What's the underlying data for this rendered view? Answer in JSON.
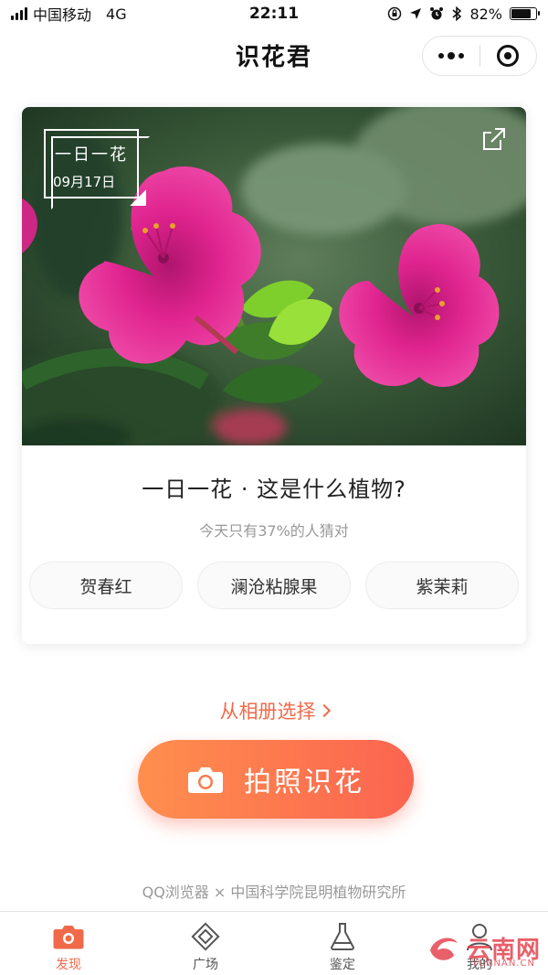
{
  "status_bar": {
    "carrier": "中国移动",
    "network": "4G",
    "time": "22:11",
    "battery_percent": "82%",
    "battery_level": 0.82
  },
  "nav": {
    "title": "识花君",
    "more_icon": "more-dots-icon",
    "close_icon": "target-circle-icon"
  },
  "card": {
    "badge_title": "一日一花",
    "badge_date": "09月17日",
    "share_icon": "share-icon",
    "question": "一日一花 · 这是什么植物?",
    "hint": "今天只有37%的人猜对",
    "options": [
      "贺春红",
      "澜沧粘腺果",
      "紫茉莉"
    ]
  },
  "album_link": "从相册选择",
  "camera_button": "拍照识花",
  "credit": "QQ浏览器 × 中国科学院昆明植物研究所",
  "tabs": [
    {
      "label": "发现",
      "icon": "camera-tab-icon",
      "active": true
    },
    {
      "label": "广场",
      "icon": "square-diamond-icon",
      "active": false
    },
    {
      "label": "鉴定",
      "icon": "flask-icon",
      "active": false
    },
    {
      "label": "我的",
      "icon": "person-icon",
      "active": false
    }
  ],
  "watermark": {
    "text": "云南网",
    "sub": "YUNNAN.CN"
  },
  "colors": {
    "accent": "#f06a4a",
    "button_start": "#ff8f4e",
    "button_end": "#fb6450",
    "flower": "#e0248f"
  }
}
